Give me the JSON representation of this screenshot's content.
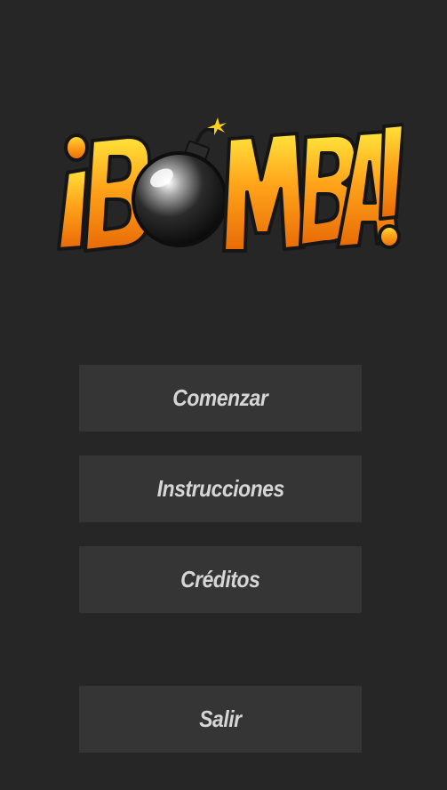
{
  "app": {
    "logo_text": "¡BOMBA!"
  },
  "menu": {
    "start_label": "Comenzar",
    "instructions_label": "Instrucciones",
    "credits_label": "Créditos",
    "exit_label": "Salir"
  },
  "colors": {
    "background": "#262626",
    "button_bg": "#353535",
    "button_text": "#d6d6d6",
    "logo_orange": "#f39a12",
    "logo_yellow": "#ffd21a",
    "logo_outline": "#1a1a1a"
  },
  "icons": {
    "logo_bomb": "bomb-icon"
  }
}
